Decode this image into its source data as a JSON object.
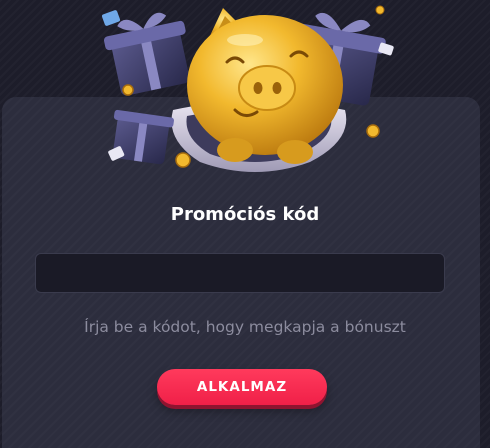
{
  "promo": {
    "title": "Promóciós kód",
    "input_value": "",
    "input_placeholder": "",
    "hint": "Írja be a kódot, hogy megkapja a bónuszt",
    "apply_label": "ALKALMAZ"
  },
  "colors": {
    "background": "#1d1d2a",
    "card": "#2c2d3d",
    "input_bg": "#1a1a26",
    "hint_text": "#8c8c9e",
    "accent": "#f02048"
  },
  "illustration": {
    "icon": "piggy-bank-with-gifts-icon"
  }
}
